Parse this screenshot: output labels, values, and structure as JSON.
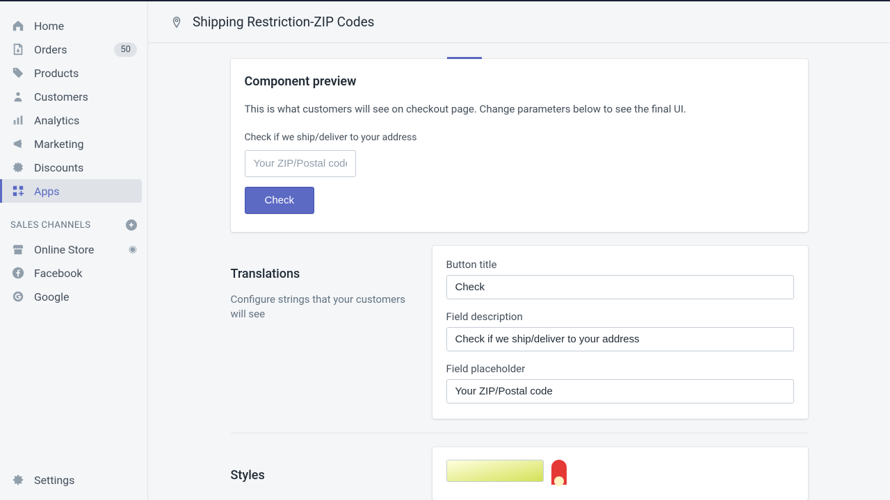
{
  "header": {
    "title": "Shipping Restriction-ZIP Codes"
  },
  "sidebar": {
    "items": [
      {
        "label": "Home"
      },
      {
        "label": "Orders",
        "badge": "50"
      },
      {
        "label": "Products"
      },
      {
        "label": "Customers"
      },
      {
        "label": "Analytics"
      },
      {
        "label": "Marketing"
      },
      {
        "label": "Discounts"
      },
      {
        "label": "Apps"
      }
    ],
    "section_label": "SALES CHANNELS",
    "channels": [
      {
        "label": "Online Store"
      },
      {
        "label": "Facebook"
      },
      {
        "label": "Google"
      }
    ],
    "settings_label": "Settings"
  },
  "preview": {
    "heading": "Component preview",
    "description": "This is what customers will see on checkout page. Change parameters below to see the final UI.",
    "field_label": "Check if we ship/deliver to your address",
    "placeholder": "Your ZIP/Postal code",
    "button_label": "Check"
  },
  "translations": {
    "heading": "Translations",
    "description": "Configure strings that your customers will see",
    "fields": {
      "button_title_label": "Button title",
      "button_title_value": "Check",
      "field_desc_label": "Field description",
      "field_desc_value": "Check if we ship/deliver to your address",
      "field_placeholder_label": "Field placeholder",
      "field_placeholder_value": "Your ZIP/Postal code"
    }
  },
  "styles": {
    "heading": "Styles"
  }
}
